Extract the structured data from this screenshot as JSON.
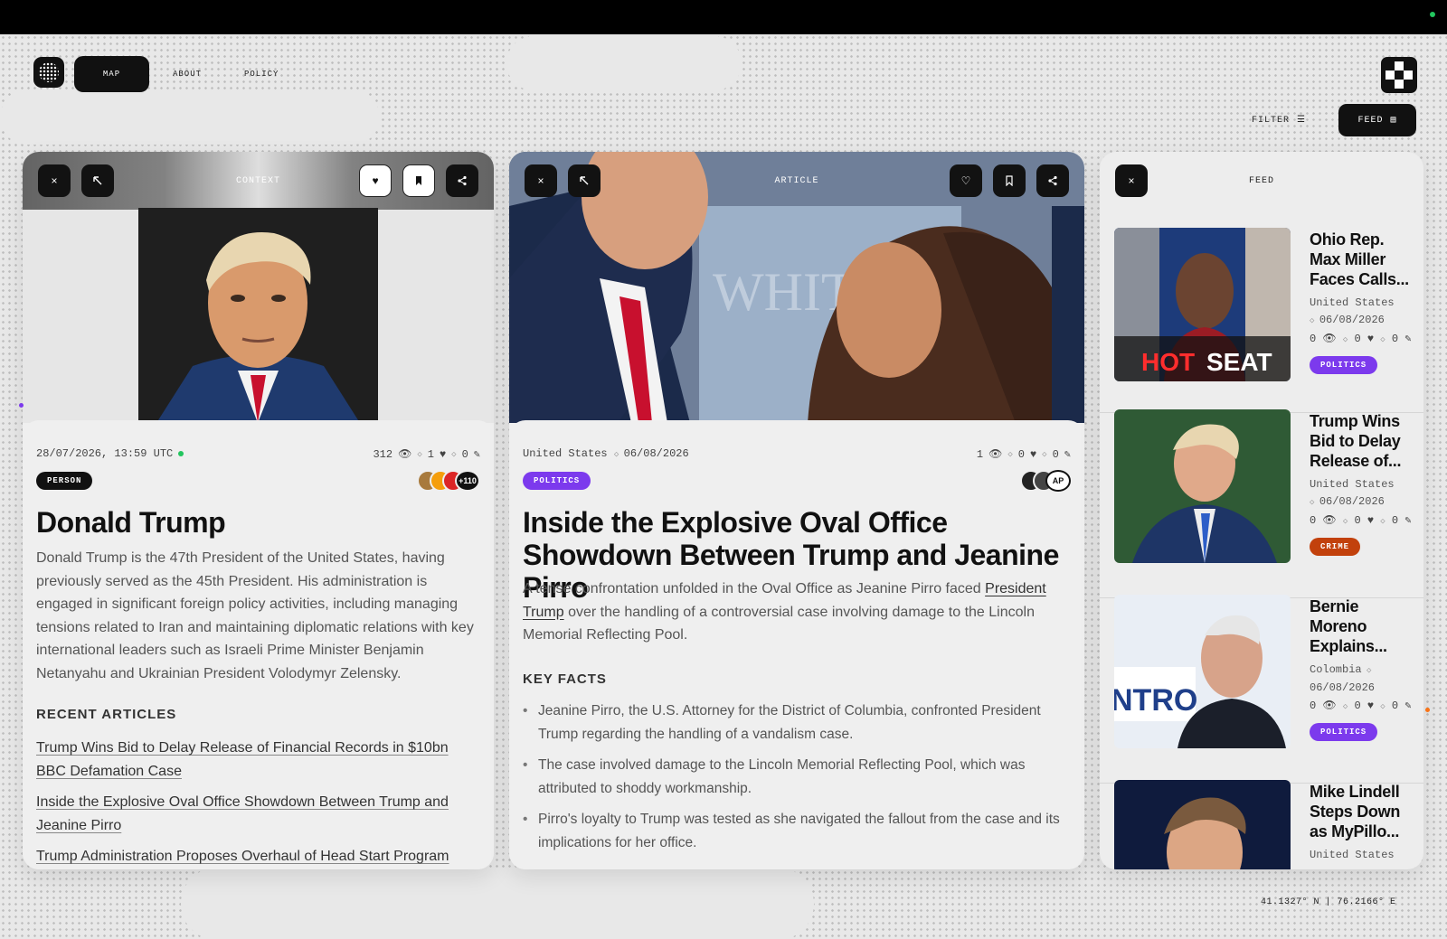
{
  "nav": {
    "items": [
      {
        "label": "MAP",
        "active": true
      },
      {
        "label": "ABOUT"
      },
      {
        "label": "POLICY"
      }
    ],
    "filter_label": "FILTER",
    "feed_label": "FEED"
  },
  "context_panel": {
    "title": "CONTEXT",
    "timestamp": "28/07/2026, 13:59 UTC",
    "views": "312",
    "likes": "1",
    "edits": "0",
    "tag": "PERSON",
    "avatar_more": "+110",
    "name": "Donald Trump",
    "description": "Donald Trump is the 47th President of the United States, having previously served as the 45th President. His administration is engaged in significant foreign policy activities, including managing tensions related to Iran and maintaining diplomatic relations with key international leaders such as Israeli Prime Minister Benjamin Netanyahu and Ukrainian President Volodymyr Zelensky.",
    "recent_heading": "RECENT ARTICLES",
    "recent_articles": [
      "Trump Wins Bid to Delay Release of Financial Records in $10bn BBC Defamation Case",
      "Inside the Explosive Oval Office Showdown Between Trump and Jeanine Pirro",
      "Trump Administration Proposes Overhaul of Head Start Program"
    ]
  },
  "article_panel": {
    "title": "ARTICLE",
    "location": "United States",
    "date": "06/08/2026",
    "views": "1",
    "likes": "0",
    "edits": "0",
    "tag": "POLITICS",
    "source_badge": "AP",
    "headline": "Inside the Explosive Oval Office Showdown Between Trump and Jeanine Pirro",
    "summary_before": "A tense confrontation unfolded in the Oval Office as Jeanine Pirro faced ",
    "summary_link": "President Trump",
    "summary_after": " over the handling of a controversial case involving damage to the Lincoln Memorial Reflecting Pool.",
    "facts_heading": "KEY FACTS",
    "facts": [
      "Jeanine Pirro, the U.S. Attorney for the District of Columbia, confronted President Trump regarding the handling of a vandalism case.",
      "The case involved damage to the Lincoln Memorial Reflecting Pool, which was attributed to shoddy workmanship.",
      "Pirro's loyalty to Trump was tested as she navigated the fallout from the case and its implications for her office."
    ]
  },
  "feed_panel": {
    "title": "FEED",
    "items": [
      {
        "title": "Ohio Rep. Max Miller Faces Calls...",
        "location": "United States",
        "date": "06/08/2026",
        "views": "0",
        "likes": "0",
        "edits": "0",
        "tag": "POLITICS",
        "tag_color": "#7c3aed",
        "thumb_text_hot": "HOT",
        "thumb_text_seat": "SEAT"
      },
      {
        "title": "Trump Wins Bid to Delay Release of...",
        "location": "United States",
        "date": "06/08/2026",
        "views": "0",
        "likes": "0",
        "edits": "0",
        "tag": "CRIME",
        "tag_color": "#c2410c"
      },
      {
        "title": "Bernie Moreno Explains...",
        "location": "Colombia",
        "date": "06/08/2026",
        "views": "0",
        "likes": "0",
        "edits": "0",
        "tag": "POLITICS",
        "tag_color": "#7c3aed",
        "thumb_text": "NTRO"
      },
      {
        "title": "Mike Lindell Steps Down as MyPillo...",
        "location": "United States"
      }
    ]
  },
  "coordinates": "41.1327° N | 76.2166° E",
  "colors": {
    "accent_purple": "#7c3aed",
    "crime_red": "#c2410c",
    "live_green": "#22c55e",
    "dark": "#111111"
  }
}
